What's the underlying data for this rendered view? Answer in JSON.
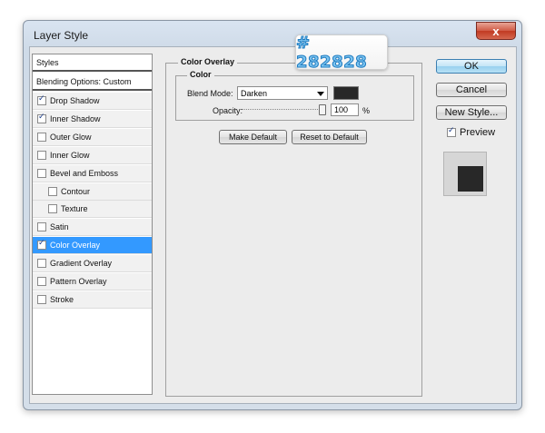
{
  "window": {
    "title": "Layer Style",
    "close_glyph": "x"
  },
  "styles_panel": {
    "header": "Styles",
    "blending": "Blending Options: Custom",
    "items": [
      {
        "label": "Drop Shadow",
        "checked": true,
        "indent": false,
        "selected": false
      },
      {
        "label": "Inner Shadow",
        "checked": true,
        "indent": false,
        "selected": false
      },
      {
        "label": "Outer Glow",
        "checked": false,
        "indent": false,
        "selected": false
      },
      {
        "label": "Inner Glow",
        "checked": false,
        "indent": false,
        "selected": false
      },
      {
        "label": "Bevel and Emboss",
        "checked": false,
        "indent": false,
        "selected": false
      },
      {
        "label": "Contour",
        "checked": false,
        "indent": true,
        "selected": false
      },
      {
        "label": "Texture",
        "checked": false,
        "indent": true,
        "selected": false
      },
      {
        "label": "Satin",
        "checked": false,
        "indent": false,
        "selected": false
      },
      {
        "label": "Color Overlay",
        "checked": true,
        "indent": false,
        "selected": true
      },
      {
        "label": "Gradient Overlay",
        "checked": false,
        "indent": false,
        "selected": false
      },
      {
        "label": "Pattern Overlay",
        "checked": false,
        "indent": false,
        "selected": false
      },
      {
        "label": "Stroke",
        "checked": false,
        "indent": false,
        "selected": false
      }
    ]
  },
  "color_overlay": {
    "group_title": "Color Overlay",
    "subgroup_title": "Color",
    "blend_mode_label": "Blend Mode:",
    "blend_mode_value": "Darken",
    "opacity_label": "Opacity:",
    "opacity_value": "100",
    "opacity_unit": "%",
    "opacity_level": 1.0,
    "color": "#282828",
    "make_default": "Make Default",
    "reset_default": "Reset to Default"
  },
  "right_buttons": {
    "ok": "OK",
    "cancel": "Cancel",
    "new_style": "New Style...",
    "preview_label": "Preview",
    "preview_checked": true
  },
  "callout": {
    "text": "# 282828",
    "color": "#282828"
  },
  "colors": {
    "selected_bg": "#3399ff",
    "ok_accent": "#98d1ef"
  }
}
